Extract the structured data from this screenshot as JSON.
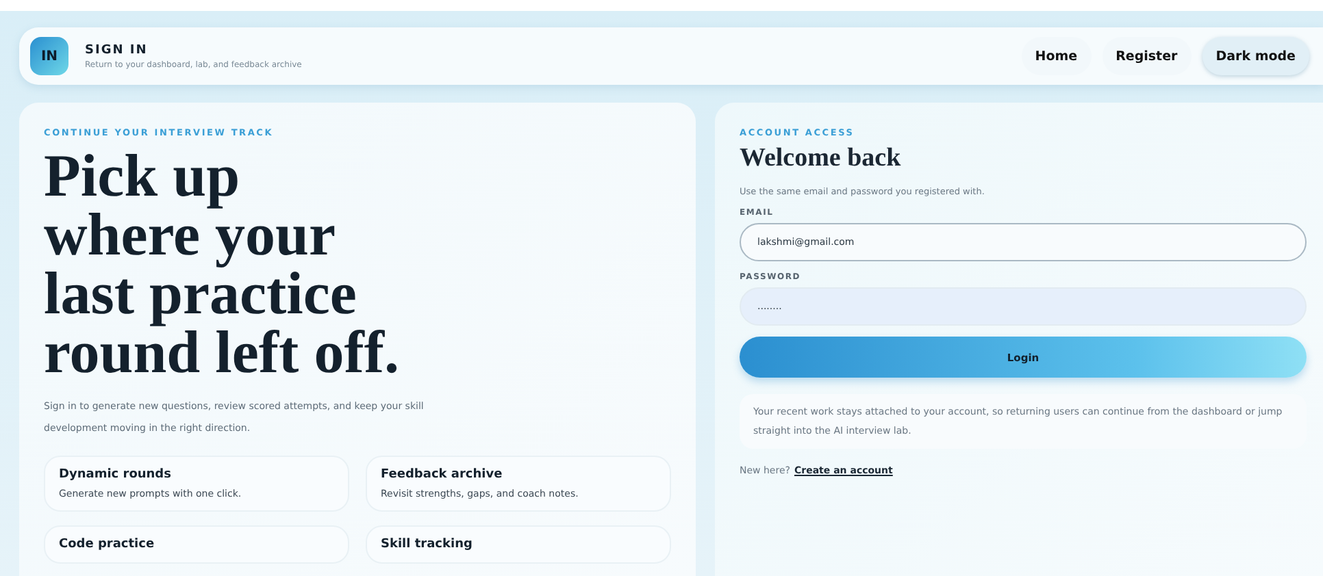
{
  "header": {
    "logo": "IN",
    "title": "SIGN IN",
    "subtitle": "Return to your dashboard, lab, and feedback archive",
    "nav": [
      {
        "label": "Home",
        "selected": false
      },
      {
        "label": "Register",
        "selected": false
      },
      {
        "label": "Dark mode",
        "selected": true
      }
    ]
  },
  "hero": {
    "eyebrow": "CONTINUE YOUR INTERVIEW TRACK",
    "headline": [
      "Pick up",
      "where your",
      "last practice",
      "round left off."
    ],
    "intro": "Sign in to generate new questions, review scored attempts, and keep your skill development moving in the right direction.",
    "features": [
      {
        "title": "Dynamic rounds",
        "text": "Generate new prompts with one click."
      },
      {
        "title": "Feedback archive",
        "text": "Revisit strengths, gaps, and coach notes."
      },
      {
        "title": "Code practice"
      },
      {
        "title": "Skill tracking"
      }
    ]
  },
  "login": {
    "eyebrow": "ACCOUNT ACCESS",
    "title": "Welcome back",
    "subtitle": "Use the same email and password you registered with.",
    "email_label": "EMAIL",
    "email_value": "lakshmi@gmail.com",
    "password_label": "PASSWORD",
    "password_value": "........",
    "button": "Login",
    "note": "Your recent work stays attached to your account, so returning users can continue from the dashboard or jump straight into the AI interview lab.",
    "footer_text": "New here?",
    "footer_link": "Create an account"
  }
}
